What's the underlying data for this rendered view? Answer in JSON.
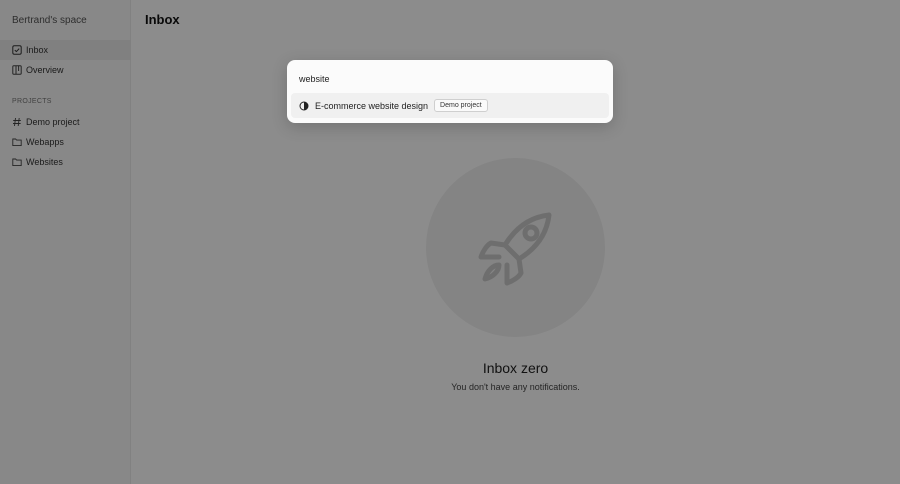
{
  "sidebar": {
    "workspace_name": "Bertrand's space",
    "nav": [
      {
        "label": "Inbox",
        "icon": "check-square-icon"
      },
      {
        "label": "Overview",
        "icon": "board-icon"
      }
    ],
    "projects_heading": "PROJECTS",
    "projects": [
      {
        "label": "Demo project",
        "icon": "hash-icon"
      },
      {
        "label": "Webapps",
        "icon": "folder-icon"
      },
      {
        "label": "Websites",
        "icon": "folder-icon"
      }
    ]
  },
  "main": {
    "title": "Inbox",
    "empty_state": {
      "icon": "rocket-icon",
      "title": "Inbox zero",
      "subtitle": "You don't have any notifications."
    }
  },
  "search_palette": {
    "query": "website",
    "results": [
      {
        "label": "E-commerce website design",
        "badge": "Demo project",
        "icon": "half-circle-status-icon"
      }
    ]
  }
}
